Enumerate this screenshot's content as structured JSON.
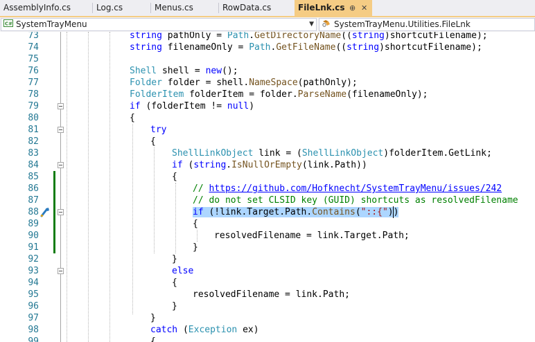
{
  "tabs": [
    {
      "label": "AssemblyInfo.cs"
    },
    {
      "label": "Log.cs"
    },
    {
      "label": "Menus.cs"
    },
    {
      "label": "RowData.cs"
    },
    {
      "label": "FileLnk.cs",
      "active": true,
      "pin": "⊕",
      "close": "✕"
    }
  ],
  "nav": {
    "project": "SystemTrayMenu",
    "class": "SystemTrayMenu.Utilities.FileLnk"
  },
  "lines": [
    {
      "n": "73",
      "text": "string pathOnly = Path.GetDirectoryName((string)shortcutFilename);"
    },
    {
      "n": "74",
      "text": "string filenameOnly = Path.GetFileName((string)shortcutFilename);"
    },
    {
      "n": "75",
      "text": ""
    },
    {
      "n": "76",
      "text": "Shell shell = new();"
    },
    {
      "n": "77",
      "text": "Folder folder = shell.NameSpace(pathOnly);"
    },
    {
      "n": "78",
      "text": "FolderItem folderItem = folder.ParseName(filenameOnly);"
    },
    {
      "n": "79",
      "text": "if (folderItem != null)"
    },
    {
      "n": "80",
      "text": "{"
    },
    {
      "n": "81",
      "text": "try"
    },
    {
      "n": "82",
      "text": "{"
    },
    {
      "n": "83",
      "text": "ShellLinkObject link = (ShellLinkObject)folderItem.GetLink;"
    },
    {
      "n": "84",
      "text": "if (string.IsNullOrEmpty(link.Path))"
    },
    {
      "n": "85",
      "text": "{"
    },
    {
      "n": "86",
      "text": "// https://github.com/Hofknecht/SystemTrayMenu/issues/242"
    },
    {
      "n": "87",
      "text": "// do not set CLSID key (GUID) shortcuts as resolvedFilename"
    },
    {
      "n": "88",
      "text": "if (!link.Target.Path.Contains(\"::{\"))"
    },
    {
      "n": "89",
      "text": "{"
    },
    {
      "n": "90",
      "text": "resolvedFilename = link.Target.Path;"
    },
    {
      "n": "91",
      "text": "}"
    },
    {
      "n": "92",
      "text": "}"
    },
    {
      "n": "93",
      "text": "else"
    },
    {
      "n": "94",
      "text": "{"
    },
    {
      "n": "95",
      "text": "resolvedFilename = link.Path;"
    },
    {
      "n": "96",
      "text": "}"
    },
    {
      "n": "97",
      "text": "}"
    },
    {
      "n": "98",
      "text": "catch (Exception ex)"
    },
    {
      "n": "99",
      "text": "{"
    }
  ],
  "colors": {
    "keyword": "#0000ff",
    "type": "#2b91af",
    "method": "#74531f",
    "comment": "#008000",
    "string": "#a31515",
    "line_number": "#237893",
    "selection": "#add6ff",
    "change_bar": "#107c10",
    "active_tab": "#f5cc84"
  },
  "icons": [
    "csharp-project-icon",
    "class-icon",
    "quick-action-icon",
    "pin-icon",
    "close-icon",
    "chevron-down-icon"
  ]
}
